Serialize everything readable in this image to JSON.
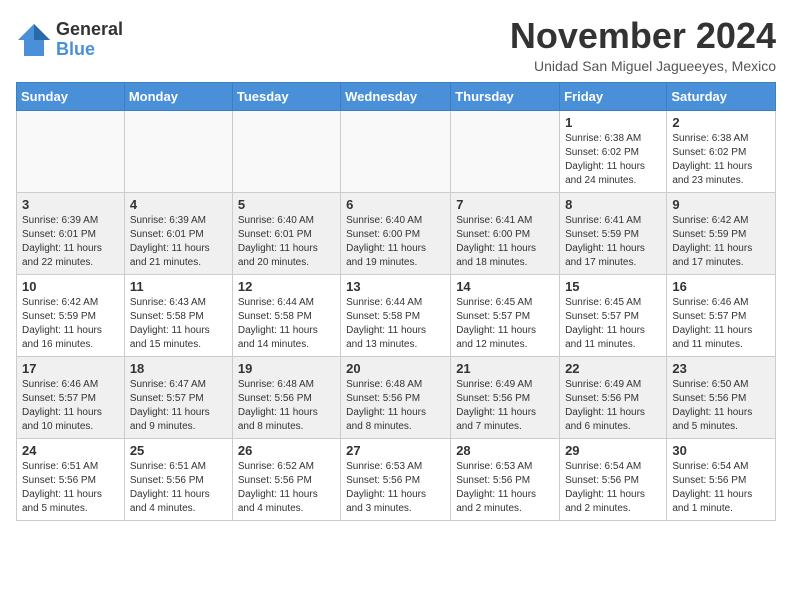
{
  "logo": {
    "general": "General",
    "blue": "Blue"
  },
  "title": "November 2024",
  "location": "Unidad San Miguel Jagueeyes, Mexico",
  "headers": [
    "Sunday",
    "Monday",
    "Tuesday",
    "Wednesday",
    "Thursday",
    "Friday",
    "Saturday"
  ],
  "weeks": [
    [
      {
        "day": "",
        "detail": ""
      },
      {
        "day": "",
        "detail": ""
      },
      {
        "day": "",
        "detail": ""
      },
      {
        "day": "",
        "detail": ""
      },
      {
        "day": "",
        "detail": ""
      },
      {
        "day": "1",
        "detail": "Sunrise: 6:38 AM\nSunset: 6:02 PM\nDaylight: 11 hours\nand 24 minutes."
      },
      {
        "day": "2",
        "detail": "Sunrise: 6:38 AM\nSunset: 6:02 PM\nDaylight: 11 hours\nand 23 minutes."
      }
    ],
    [
      {
        "day": "3",
        "detail": "Sunrise: 6:39 AM\nSunset: 6:01 PM\nDaylight: 11 hours\nand 22 minutes."
      },
      {
        "day": "4",
        "detail": "Sunrise: 6:39 AM\nSunset: 6:01 PM\nDaylight: 11 hours\nand 21 minutes."
      },
      {
        "day": "5",
        "detail": "Sunrise: 6:40 AM\nSunset: 6:01 PM\nDaylight: 11 hours\nand 20 minutes."
      },
      {
        "day": "6",
        "detail": "Sunrise: 6:40 AM\nSunset: 6:00 PM\nDaylight: 11 hours\nand 19 minutes."
      },
      {
        "day": "7",
        "detail": "Sunrise: 6:41 AM\nSunset: 6:00 PM\nDaylight: 11 hours\nand 18 minutes."
      },
      {
        "day": "8",
        "detail": "Sunrise: 6:41 AM\nSunset: 5:59 PM\nDaylight: 11 hours\nand 17 minutes."
      },
      {
        "day": "9",
        "detail": "Sunrise: 6:42 AM\nSunset: 5:59 PM\nDaylight: 11 hours\nand 17 minutes."
      }
    ],
    [
      {
        "day": "10",
        "detail": "Sunrise: 6:42 AM\nSunset: 5:59 PM\nDaylight: 11 hours\nand 16 minutes."
      },
      {
        "day": "11",
        "detail": "Sunrise: 6:43 AM\nSunset: 5:58 PM\nDaylight: 11 hours\nand 15 minutes."
      },
      {
        "day": "12",
        "detail": "Sunrise: 6:44 AM\nSunset: 5:58 PM\nDaylight: 11 hours\nand 14 minutes."
      },
      {
        "day": "13",
        "detail": "Sunrise: 6:44 AM\nSunset: 5:58 PM\nDaylight: 11 hours\nand 13 minutes."
      },
      {
        "day": "14",
        "detail": "Sunrise: 6:45 AM\nSunset: 5:57 PM\nDaylight: 11 hours\nand 12 minutes."
      },
      {
        "day": "15",
        "detail": "Sunrise: 6:45 AM\nSunset: 5:57 PM\nDaylight: 11 hours\nand 11 minutes."
      },
      {
        "day": "16",
        "detail": "Sunrise: 6:46 AM\nSunset: 5:57 PM\nDaylight: 11 hours\nand 11 minutes."
      }
    ],
    [
      {
        "day": "17",
        "detail": "Sunrise: 6:46 AM\nSunset: 5:57 PM\nDaylight: 11 hours\nand 10 minutes."
      },
      {
        "day": "18",
        "detail": "Sunrise: 6:47 AM\nSunset: 5:57 PM\nDaylight: 11 hours\nand 9 minutes."
      },
      {
        "day": "19",
        "detail": "Sunrise: 6:48 AM\nSunset: 5:56 PM\nDaylight: 11 hours\nand 8 minutes."
      },
      {
        "day": "20",
        "detail": "Sunrise: 6:48 AM\nSunset: 5:56 PM\nDaylight: 11 hours\nand 8 minutes."
      },
      {
        "day": "21",
        "detail": "Sunrise: 6:49 AM\nSunset: 5:56 PM\nDaylight: 11 hours\nand 7 minutes."
      },
      {
        "day": "22",
        "detail": "Sunrise: 6:49 AM\nSunset: 5:56 PM\nDaylight: 11 hours\nand 6 minutes."
      },
      {
        "day": "23",
        "detail": "Sunrise: 6:50 AM\nSunset: 5:56 PM\nDaylight: 11 hours\nand 5 minutes."
      }
    ],
    [
      {
        "day": "24",
        "detail": "Sunrise: 6:51 AM\nSunset: 5:56 PM\nDaylight: 11 hours\nand 5 minutes."
      },
      {
        "day": "25",
        "detail": "Sunrise: 6:51 AM\nSunset: 5:56 PM\nDaylight: 11 hours\nand 4 minutes."
      },
      {
        "day": "26",
        "detail": "Sunrise: 6:52 AM\nSunset: 5:56 PM\nDaylight: 11 hours\nand 4 minutes."
      },
      {
        "day": "27",
        "detail": "Sunrise: 6:53 AM\nSunset: 5:56 PM\nDaylight: 11 hours\nand 3 minutes."
      },
      {
        "day": "28",
        "detail": "Sunrise: 6:53 AM\nSunset: 5:56 PM\nDaylight: 11 hours\nand 2 minutes."
      },
      {
        "day": "29",
        "detail": "Sunrise: 6:54 AM\nSunset: 5:56 PM\nDaylight: 11 hours\nand 2 minutes."
      },
      {
        "day": "30",
        "detail": "Sunrise: 6:54 AM\nSunset: 5:56 PM\nDaylight: 11 hours\nand 1 minute."
      }
    ]
  ]
}
